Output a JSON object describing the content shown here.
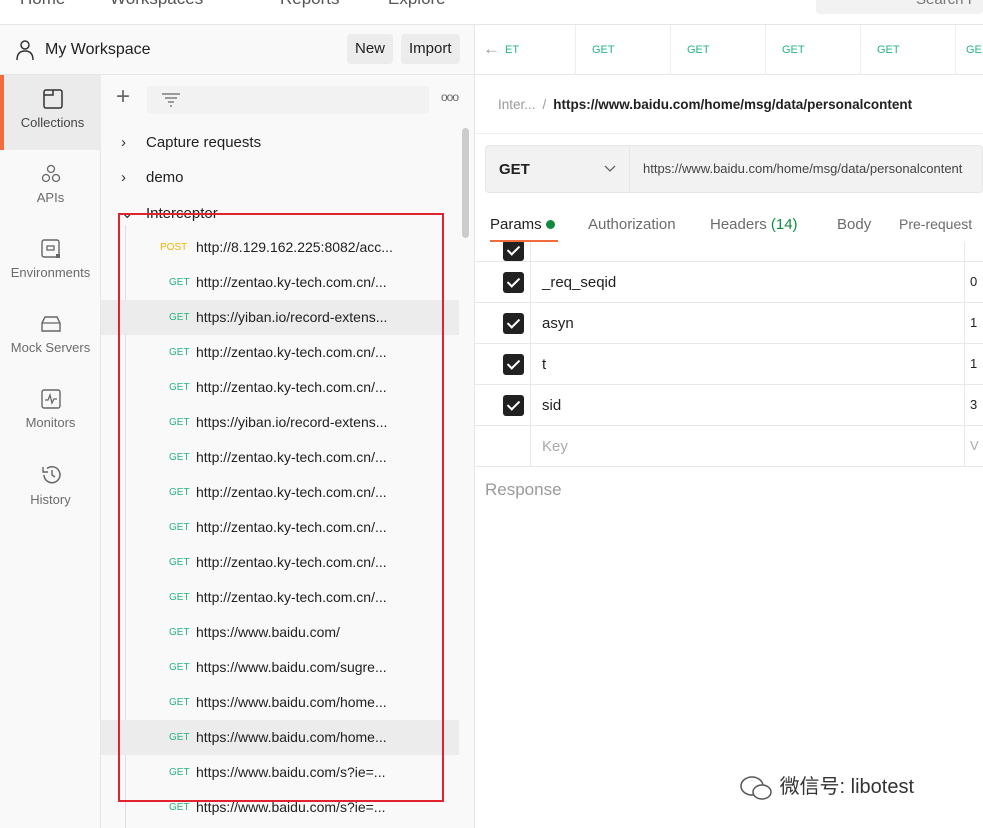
{
  "topnav": {
    "items": [
      "Home",
      "Workspaces",
      "Reports",
      "Explore"
    ],
    "search": "Search P"
  },
  "workspace": {
    "title": "My Workspace",
    "new_label": "New",
    "import_label": "Import"
  },
  "open_tabs": [
    "ET",
    "GET",
    "GET",
    "GET",
    "GET",
    "GE"
  ],
  "sidebar": {
    "items": [
      {
        "label": "Collections",
        "icon": "collections-icon",
        "active": true
      },
      {
        "label": "APIs",
        "icon": "apis-icon"
      },
      {
        "label": "Environments",
        "icon": "environments-icon"
      },
      {
        "label": "Mock Servers",
        "icon": "mock-servers-icon"
      },
      {
        "label": "Monitors",
        "icon": "monitors-icon"
      },
      {
        "label": "History",
        "icon": "history-icon"
      }
    ]
  },
  "collections": {
    "folders": [
      "Capture requests",
      "demo",
      "Interceptor"
    ],
    "requests": [
      {
        "method": "POST",
        "url": "http://8.129.162.225:8082/acc..."
      },
      {
        "method": "GET",
        "url": "http://zentao.ky-tech.com.cn/..."
      },
      {
        "method": "GET",
        "url": "https://yiban.io/record-extens...",
        "selected": true
      },
      {
        "method": "GET",
        "url": "http://zentao.ky-tech.com.cn/..."
      },
      {
        "method": "GET",
        "url": "http://zentao.ky-tech.com.cn/..."
      },
      {
        "method": "GET",
        "url": "https://yiban.io/record-extens..."
      },
      {
        "method": "GET",
        "url": "http://zentao.ky-tech.com.cn/..."
      },
      {
        "method": "GET",
        "url": "http://zentao.ky-tech.com.cn/..."
      },
      {
        "method": "GET",
        "url": "http://zentao.ky-tech.com.cn/..."
      },
      {
        "method": "GET",
        "url": "http://zentao.ky-tech.com.cn/..."
      },
      {
        "method": "GET",
        "url": "http://zentao.ky-tech.com.cn/..."
      },
      {
        "method": "GET",
        "url": "https://www.baidu.com/"
      },
      {
        "method": "GET",
        "url": "https://www.baidu.com/sugre..."
      },
      {
        "method": "GET",
        "url": "https://www.baidu.com/home..."
      },
      {
        "method": "GET",
        "url": "https://www.baidu.com/home...",
        "selected": true
      },
      {
        "method": "GET",
        "url": "https://www.baidu.com/s?ie=..."
      },
      {
        "method": "GET",
        "url": "https://www.baidu.com/s?ie=..."
      }
    ]
  },
  "request": {
    "breadcrumb_parent": "Inter...",
    "breadcrumb_current": "https://www.baidu.com/home/msg/data/personalcontent",
    "method": "GET",
    "url": "https://www.baidu.com/home/msg/data/personalcontent",
    "tabs": {
      "params": "Params",
      "authorization": "Authorization",
      "headers": "Headers",
      "headers_count": "(14)",
      "body": "Body",
      "prerequest": "Pre-request"
    },
    "params": [
      {
        "key": "_req_seqid",
        "value": "0"
      },
      {
        "key": "asyn",
        "value": "1"
      },
      {
        "key": "t",
        "value": "1"
      },
      {
        "key": "sid",
        "value": "3"
      }
    ],
    "key_placeholder": "Key",
    "value_placeholder": "V",
    "response_label": "Response"
  },
  "colors": {
    "accent": "#f26b3a",
    "get": "#26b47f",
    "post": "#f0b400",
    "highlight_box": "#e0232e"
  },
  "watermark": "微信号: libotest"
}
